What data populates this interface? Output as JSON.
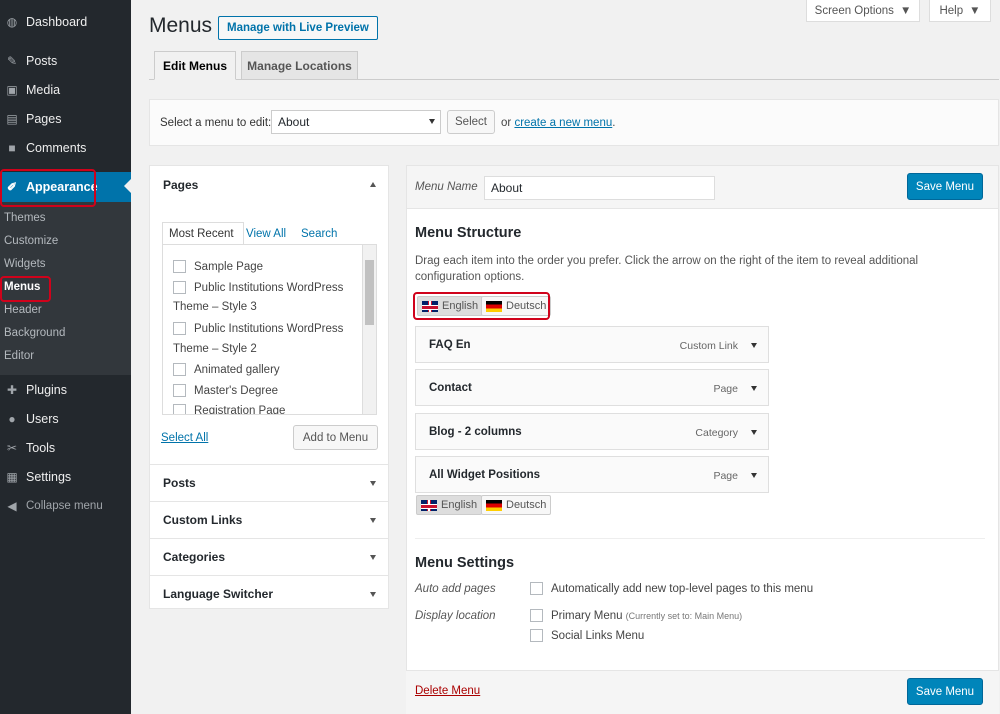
{
  "sidebar": {
    "items": [
      {
        "label": "Dashboard",
        "icon": "dashboard-icon",
        "glyph": "◍"
      },
      {
        "label": "Posts",
        "icon": "pin-icon",
        "glyph": "✎"
      },
      {
        "label": "Media",
        "icon": "media-icon",
        "glyph": "▣"
      },
      {
        "label": "Pages",
        "icon": "pages-icon",
        "glyph": "▤"
      },
      {
        "label": "Comments",
        "icon": "comments-icon",
        "glyph": "■"
      },
      {
        "label": "Appearance",
        "icon": "paintbrush-icon",
        "glyph": "✐"
      },
      {
        "label": "Plugins",
        "icon": "plugins-icon",
        "glyph": "✚"
      },
      {
        "label": "Users",
        "icon": "users-icon",
        "glyph": "●"
      },
      {
        "label": "Tools",
        "icon": "tools-icon",
        "glyph": "✂"
      },
      {
        "label": "Settings",
        "icon": "settings-icon",
        "glyph": "▦"
      },
      {
        "label": "Collapse menu",
        "icon": "collapse-icon",
        "glyph": "◀"
      }
    ],
    "submenu": [
      "Themes",
      "Customize",
      "Widgets",
      "Menus",
      "Header",
      "Background",
      "Editor"
    ]
  },
  "topbar": {
    "screen_options": "Screen Options",
    "help": "Help"
  },
  "header": {
    "title": "Menus",
    "live_preview": "Manage with Live Preview"
  },
  "tabs": {
    "edit": "Edit Menus",
    "locations": "Manage Locations"
  },
  "select_bar": {
    "label": "Select a menu to edit:",
    "selected": "About",
    "select_button": "Select",
    "or_text": "or",
    "create_link": "create a new menu",
    "period": "."
  },
  "left": {
    "pages_title": "Pages",
    "inner_tabs": [
      "Most Recent",
      "View All",
      "Search"
    ],
    "rows": [
      {
        "label": "Sample Page",
        "checkbox": true
      },
      {
        "label": "Public Institutions WordPress",
        "checkbox": true
      },
      {
        "label": "Theme – Style 3",
        "checkbox": false
      },
      {
        "label": "Public Institutions WordPress",
        "checkbox": true
      },
      {
        "label": "Theme – Style 2",
        "checkbox": false
      },
      {
        "label": "Animated gallery",
        "checkbox": true
      },
      {
        "label": "Master's Degree",
        "checkbox": true
      },
      {
        "label": "Registration Page",
        "checkbox": true
      }
    ],
    "select_all": "Select All",
    "add_to_menu": "Add to Menu",
    "sections": [
      "Posts",
      "Custom Links",
      "Categories",
      "Language Switcher"
    ]
  },
  "right": {
    "menu_name_label": "Menu Name",
    "menu_name_value": "About",
    "save_menu": "Save Menu",
    "structure_title": "Menu Structure",
    "structure_desc": "Drag each item into the order you prefer. Click the arrow on the right of the item to reveal additional configuration options.",
    "languages": [
      "English",
      "Deutsch"
    ],
    "items": [
      {
        "title": "FAQ En",
        "type": "Custom Link"
      },
      {
        "title": "Contact",
        "type": "Page"
      },
      {
        "title": "Blog - 2 columns",
        "type": "Category"
      },
      {
        "title": "All Widget Positions",
        "type": "Page"
      }
    ],
    "settings_title": "Menu Settings",
    "auto_add_label": "Auto add pages",
    "auto_add_text": "Automatically add new top-level pages to this menu",
    "display_location_label": "Display location",
    "primary_menu": "Primary Menu",
    "primary_note": "(Currently set to: Main Menu)",
    "social_menu": "Social Links Menu",
    "delete_menu": "Delete Menu"
  },
  "colors": {
    "accent": "#0073aa",
    "highlight": "#d0021b",
    "sidebar": "#23282d"
  }
}
